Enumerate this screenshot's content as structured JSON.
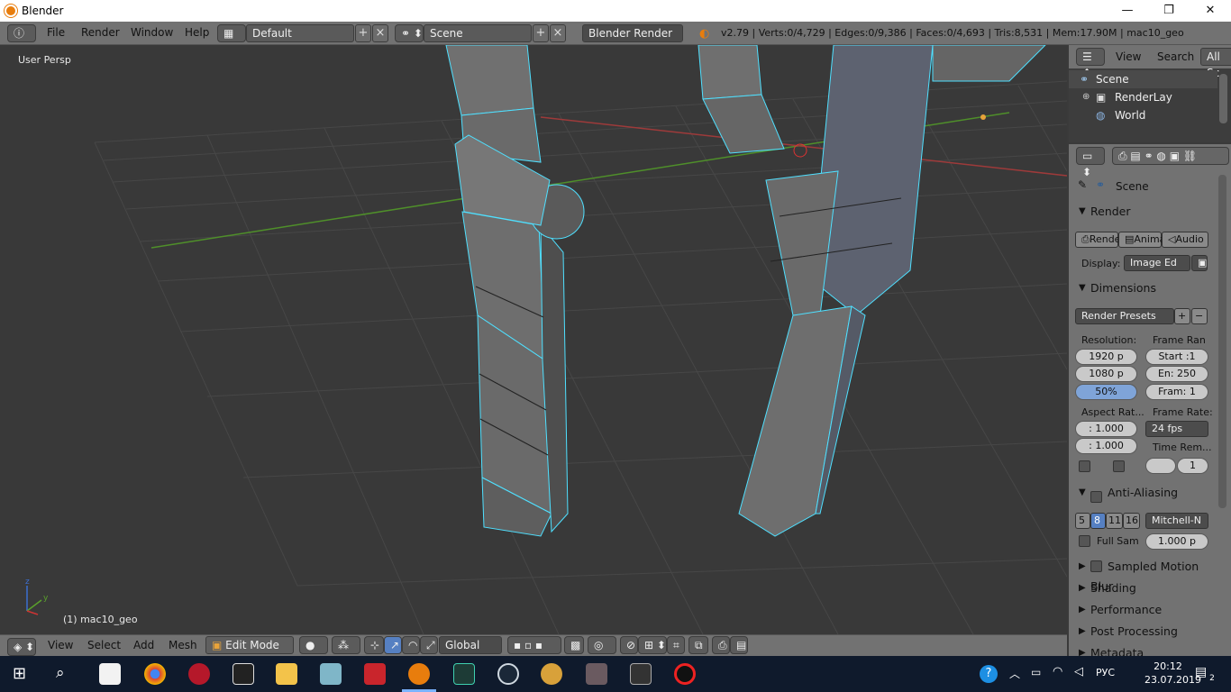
{
  "window": {
    "title": "Blender",
    "minimize": "—",
    "maximize": "❐",
    "close": "✕"
  },
  "menu": {
    "file": "File",
    "render": "Render",
    "window": "Window",
    "help": "Help"
  },
  "layout": {
    "value": "Default"
  },
  "scene": {
    "value": "Scene"
  },
  "engine": {
    "value": "Blender Render"
  },
  "stats": "v2.79 | Verts:0/4,729 | Edges:0/9,386 | Faces:0/4,693 | Tris:8,531 | Mem:17.90M | mac10_geo",
  "viewport": {
    "label": "User Persp",
    "object": "(1) mac10_geo"
  },
  "vp_header": {
    "view": "View",
    "select": "Select",
    "add": "Add",
    "mesh": "Mesh",
    "mode": "Edit Mode",
    "orientation": "Global"
  },
  "outliner": {
    "view": "View",
    "search": "Search",
    "filter": "All Sc",
    "items": [
      {
        "label": "Scene"
      },
      {
        "label": "RenderLay"
      },
      {
        "label": "World"
      }
    ]
  },
  "props": {
    "scene": "Scene",
    "render_panel": "Render",
    "render_btn": "Rende",
    "anim_btn": "Anima",
    "audio_btn": "Audio",
    "display_label": "Display:",
    "display_value": "Image Ed",
    "dimensions": "Dimensions",
    "presets": "Render Presets",
    "resolution": "Resolution:",
    "res_x": "1920 p",
    "res_y": "1080 p",
    "res_pct": "50%",
    "frame_range": "Frame Ran",
    "start": "Start :1",
    "end": "En: 250",
    "frame": "Fram: 1",
    "aspect": "Aspect Rat...",
    "aspect_x": ": 1.000",
    "aspect_y": ": 1.000",
    "frame_rate": "Frame Rate:",
    "fps": "24 fps",
    "time_remap": "Time Rem...",
    "time_val": "1",
    "aa": "Anti-Aliasing",
    "aa_samples": [
      "5",
      "8",
      "11",
      "16"
    ],
    "aa_filter": "Mitchell-N",
    "full_sample": "Full Sam",
    "filter_size": "1.000 p",
    "motion_blur": "Sampled Motion Blur",
    "shading": "Shading",
    "performance": "Performance",
    "post": "Post Processing",
    "metadata": "Metadata"
  },
  "taskbar": {
    "lang": "РУС",
    "time": "20:12",
    "date": "23.07.2019",
    "notif": "2"
  },
  "colors": {
    "edge_select": "#4fe0ff",
    "mesh_face": "#6f6f6f",
    "mesh_dark": "#5d6270",
    "x_axis": "#9e3a3a",
    "y_axis": "#4f8f2a"
  }
}
